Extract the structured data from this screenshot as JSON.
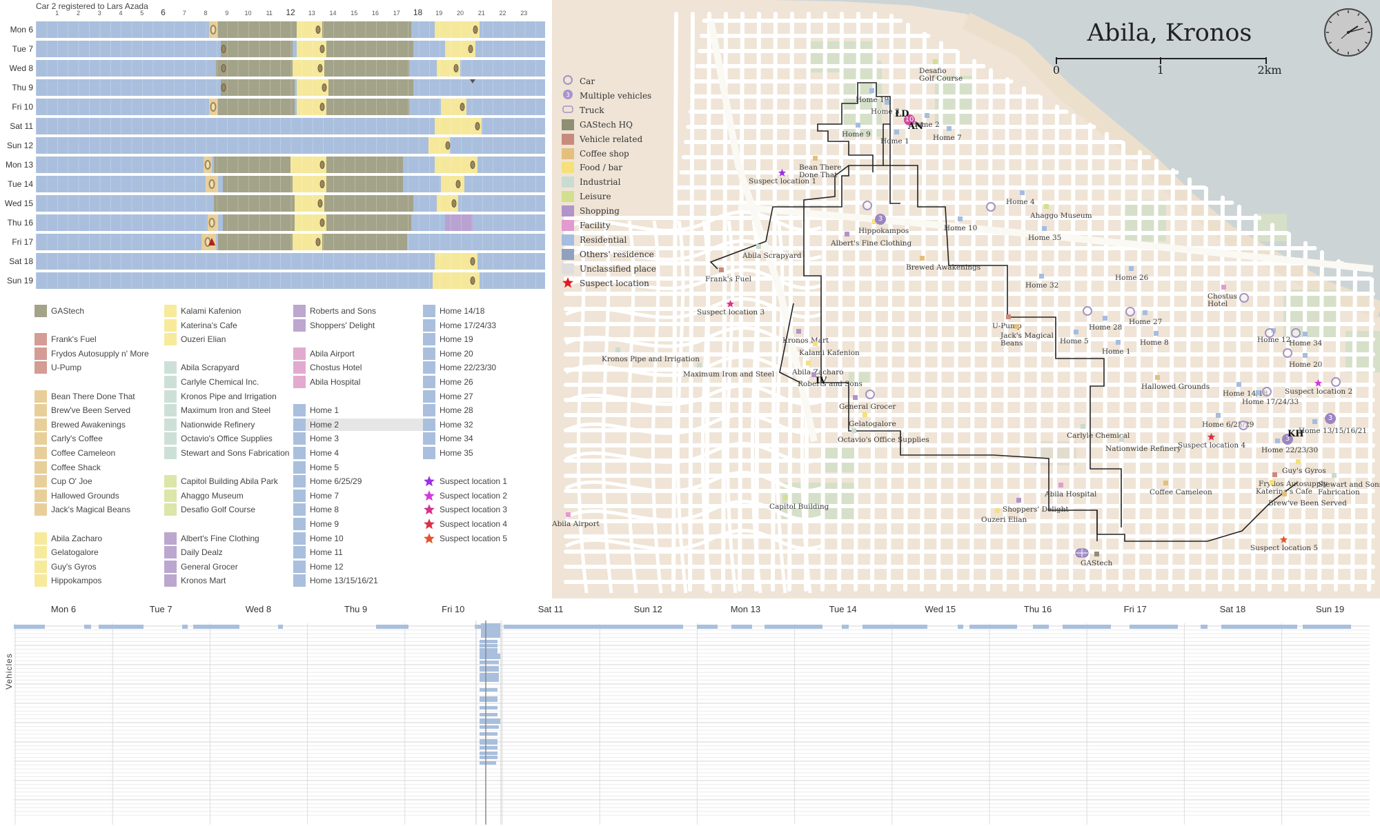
{
  "calendar": {
    "title": "Car 2 registered to Lars Azada",
    "hour_ticks": [
      "1",
      "2",
      "3",
      "4",
      "5",
      "6",
      "7",
      "8",
      "9",
      "10",
      "11",
      "12",
      "13",
      "14",
      "15",
      "16",
      "17",
      "18",
      "19",
      "20",
      "21",
      "22",
      "23"
    ],
    "major_hours": [
      "6",
      "12",
      "18"
    ],
    "days": [
      {
        "label": "Mon 6"
      },
      {
        "label": "Tue 7"
      },
      {
        "label": "Wed 8"
      },
      {
        "label": "Thu 9"
      },
      {
        "label": "Fri 10"
      },
      {
        "label": "Sat 11"
      },
      {
        "label": "Sun 12"
      },
      {
        "label": "Mon 13"
      },
      {
        "label": "Tue 14"
      },
      {
        "label": "Wed 15"
      },
      {
        "label": "Thu 16"
      },
      {
        "label": "Fri 17"
      },
      {
        "label": "Sat 18"
      },
      {
        "label": "Sun 19"
      }
    ],
    "colors": {
      "residential": "#a9bfdd",
      "gastech": "#a3a389",
      "food": "#f5e89a",
      "coffee": "#e8cf99",
      "shopping": "#b9a2d2",
      "background": "#ffffff"
    }
  },
  "legend": {
    "columns": [
      [
        {
          "label": "GAStech",
          "color": "#a3a389"
        },
        {
          "label": "",
          "color": ""
        },
        {
          "label": "Frank's Fuel",
          "color": "#d49c93"
        },
        {
          "label": "Frydos Autosupply n' More",
          "color": "#d49c93"
        },
        {
          "label": "U-Pump",
          "color": "#d49c93"
        },
        {
          "label": "",
          "color": ""
        },
        {
          "label": "Bean There Done That",
          "color": "#e8cf99"
        },
        {
          "label": "Brew've Been Served",
          "color": "#e8cf99"
        },
        {
          "label": "Brewed Awakenings",
          "color": "#e8cf99"
        },
        {
          "label": "Carly's Coffee",
          "color": "#e8cf99"
        },
        {
          "label": "Coffee Cameleon",
          "color": "#e8cf99"
        },
        {
          "label": "Coffee Shack",
          "color": "#e8cf99"
        },
        {
          "label": "Cup O' Joe",
          "color": "#e8cf99"
        },
        {
          "label": "Hallowed Grounds",
          "color": "#e8cf99"
        },
        {
          "label": "Jack's Magical Beans",
          "color": "#e8cf99"
        },
        {
          "label": "",
          "color": ""
        },
        {
          "label": "Abila Zacharo",
          "color": "#f7ea9a"
        },
        {
          "label": "Gelatogalore",
          "color": "#f7ea9a"
        },
        {
          "label": "Guy's Gyros",
          "color": "#f7ea9a"
        },
        {
          "label": "Hippokampos",
          "color": "#f7ea9a"
        }
      ],
      [
        {
          "label": "Kalami Kafenion",
          "color": "#f7ea9a"
        },
        {
          "label": "Katerina's Cafe",
          "color": "#f7ea9a"
        },
        {
          "label": "Ouzeri Elian",
          "color": "#f7ea9a"
        },
        {
          "label": "",
          "color": ""
        },
        {
          "label": "Abila Scrapyard",
          "color": "#cde0d8"
        },
        {
          "label": "Carlyle Chemical Inc.",
          "color": "#cde0d8"
        },
        {
          "label": "Kronos Pipe and Irrigation",
          "color": "#cde0d8"
        },
        {
          "label": "Maximum Iron and Steel",
          "color": "#cde0d8"
        },
        {
          "label": "Nationwide Refinery",
          "color": "#cde0d8"
        },
        {
          "label": "Octavio's Office Supplies",
          "color": "#cde0d8"
        },
        {
          "label": "Stewart and Sons Fabrication",
          "color": "#cde0d8"
        },
        {
          "label": "",
          "color": ""
        },
        {
          "label": "Capitol Building Abila Park",
          "color": "#dbe6a8"
        },
        {
          "label": "Ahaggo Museum",
          "color": "#dbe6a8"
        },
        {
          "label": "Desafio Golf Course",
          "color": "#dbe6a8"
        },
        {
          "label": "",
          "color": ""
        },
        {
          "label": "Albert's Fine Clothing",
          "color": "#bca7cf"
        },
        {
          "label": "Daily Dealz",
          "color": "#bca7cf"
        },
        {
          "label": "General Grocer",
          "color": "#bca7cf"
        },
        {
          "label": "Kronos Mart",
          "color": "#bca7cf"
        }
      ],
      [
        {
          "label": "Roberts and Sons",
          "color": "#bca7cf"
        },
        {
          "label": "Shoppers' Delight",
          "color": "#bca7cf"
        },
        {
          "label": "",
          "color": ""
        },
        {
          "label": "Abila Airport",
          "color": "#e2aad0"
        },
        {
          "label": "Chostus Hotel",
          "color": "#e2aad0"
        },
        {
          "label": "Abila Hospital",
          "color": "#e2aad0"
        },
        {
          "label": "",
          "color": ""
        },
        {
          "label": "Home 1",
          "color": "#a9bfdd"
        },
        {
          "label": "Home 2",
          "color": "#a9bfdd",
          "highlight": true
        },
        {
          "label": "Home 3",
          "color": "#a9bfdd"
        },
        {
          "label": "Home 4",
          "color": "#a9bfdd"
        },
        {
          "label": "Home 5",
          "color": "#a9bfdd"
        },
        {
          "label": "Home 6/25/29",
          "color": "#a9bfdd"
        },
        {
          "label": "Home 7",
          "color": "#a9bfdd"
        },
        {
          "label": "Home 8",
          "color": "#a9bfdd"
        },
        {
          "label": "Home 9",
          "color": "#a9bfdd"
        },
        {
          "label": "Home 10",
          "color": "#a9bfdd"
        },
        {
          "label": "Home 11",
          "color": "#a9bfdd"
        },
        {
          "label": "Home 12",
          "color": "#a9bfdd"
        },
        {
          "label": "Home 13/15/16/21",
          "color": "#a9bfdd"
        }
      ],
      [
        {
          "label": "Home 14/18",
          "color": "#a9bfdd"
        },
        {
          "label": "Home 17/24/33",
          "color": "#a9bfdd"
        },
        {
          "label": "Home 19",
          "color": "#a9bfdd"
        },
        {
          "label": "Home 20",
          "color": "#a9bfdd"
        },
        {
          "label": "Home 22/23/30",
          "color": "#a9bfdd"
        },
        {
          "label": "Home 26",
          "color": "#a9bfdd"
        },
        {
          "label": "Home 27",
          "color": "#a9bfdd"
        },
        {
          "label": "Home 28",
          "color": "#a9bfdd"
        },
        {
          "label": "Home 32",
          "color": "#a9bfdd"
        },
        {
          "label": "Home 34",
          "color": "#a9bfdd"
        },
        {
          "label": "Home 35",
          "color": "#a9bfdd"
        },
        {
          "label": "",
          "color": ""
        },
        {
          "label": "Suspect location 1",
          "color": "#9b30e8",
          "star": true
        },
        {
          "label": "Suspect location 2",
          "color": "#d43ad8",
          "star": true
        },
        {
          "label": "Suspect location 3",
          "color": "#d7318f",
          "star": true
        },
        {
          "label": "Suspect location 4",
          "color": "#d83045",
          "star": true
        },
        {
          "label": "Suspect location 5",
          "color": "#e2542e",
          "star": true
        }
      ]
    ]
  },
  "map": {
    "title": "Abila, Kronos",
    "scale": {
      "labels": [
        "0",
        "1",
        "2km"
      ]
    },
    "legend": [
      {
        "label": "Car",
        "kind": "car"
      },
      {
        "label": "Multiple vehicles",
        "kind": "multi",
        "badge": "3"
      },
      {
        "label": "Truck",
        "kind": "truck"
      },
      {
        "label": "GAStech HQ",
        "color": "#8f8f73"
      },
      {
        "label": "Vehicle related",
        "color": "#c98a7e"
      },
      {
        "label": "Coffee shop",
        "color": "#e3c07e"
      },
      {
        "label": "Food / bar",
        "color": "#f5e07c"
      },
      {
        "label": "Industrial",
        "color": "#c8dcd2"
      },
      {
        "label": "Leisure",
        "color": "#d1df8f"
      },
      {
        "label": "Shopping",
        "color": "#b293cc"
      },
      {
        "label": "Facility",
        "color": "#e39ad0"
      },
      {
        "label": "Residential",
        "color": "#a5bde0"
      },
      {
        "label": "Others' residence",
        "color": "#8fa1bf"
      },
      {
        "label": "Unclassified place",
        "color": "#dedede"
      },
      {
        "label": "Suspect location",
        "kind": "star",
        "color": "#e01c22"
      }
    ],
    "places": [
      {
        "label": "Desafio Golf Course",
        "lines": [
          "Desafio",
          "Golf Course"
        ]
      },
      {
        "label": "Home 19"
      },
      {
        "label": "Home 3"
      },
      {
        "label": "Home 2"
      },
      {
        "label": "Home 9"
      },
      {
        "label": "Home 1"
      },
      {
        "label": "Home 7"
      },
      {
        "label": "Bean There Done That",
        "lines": [
          "Bean There",
          "Done That"
        ]
      },
      {
        "label": "Suspect location 1"
      },
      {
        "label": "Home 4"
      },
      {
        "label": "Ahaggo Museum"
      },
      {
        "label": "Home 35"
      },
      {
        "label": "Hippokampos"
      },
      {
        "label": "Home 10"
      },
      {
        "label": "Albert's Fine Clothing"
      },
      {
        "label": "Abila Scrapyard"
      },
      {
        "label": "Brewed Awakenings"
      },
      {
        "label": "Home 32"
      },
      {
        "label": "Home 26"
      },
      {
        "label": "Frank's Fuel"
      },
      {
        "label": "Chostus Hotel",
        "lines": [
          "Chostus",
          "Hotel"
        ]
      },
      {
        "label": "Suspect location 3"
      },
      {
        "label": "U-Pump"
      },
      {
        "label": "Jack's Magical Beans",
        "lines": [
          "Jack's Magical",
          "Beans"
        ]
      },
      {
        "label": "Home 28"
      },
      {
        "label": "Home 27"
      },
      {
        "label": "Home 5"
      },
      {
        "label": "Home 8"
      },
      {
        "label": "Home 1"
      },
      {
        "label": "Home 12"
      },
      {
        "label": "Home 34"
      },
      {
        "label": "Kronos Mart"
      },
      {
        "label": "Kalami Kafenion"
      },
      {
        "label": "Kronos Pipe and Irrigation"
      },
      {
        "label": "Home 20"
      },
      {
        "label": "Maximum Iron and Steel"
      },
      {
        "label": "Abila Zacharo"
      },
      {
        "label": "Roberts and Sons"
      },
      {
        "label": "Hallowed Grounds"
      },
      {
        "label": "Home 14/18"
      },
      {
        "label": "Suspect location 2"
      },
      {
        "label": "Home 17/24/33"
      },
      {
        "label": "General Grocer"
      },
      {
        "label": "Gelatogalore"
      },
      {
        "label": "Home 6/25/29"
      },
      {
        "label": "Home 13/15/16/21"
      },
      {
        "label": "Carlyle Chemical"
      },
      {
        "label": "Octavio's Office Supplies"
      },
      {
        "label": "Nationwide Refinery"
      },
      {
        "label": "Suspect location 4"
      },
      {
        "label": "Home 22/23/30"
      },
      {
        "label": "Guy's Gyros"
      },
      {
        "label": "Frydos Autosupply"
      },
      {
        "label": "Stewart and Sons Fabrication",
        "lines": [
          "Stewart and Sons",
          "Fabrication"
        ]
      },
      {
        "label": "Abila Hospital"
      },
      {
        "label": "Coffee Cameleon"
      },
      {
        "label": "Katerina's Cafe"
      },
      {
        "label": "Brew've Been Served"
      },
      {
        "label": "Capitol Building"
      },
      {
        "label": "Shoppers' Delight"
      },
      {
        "label": "Ouzeri Elian"
      },
      {
        "label": "Abila Airport"
      },
      {
        "label": "Suspect location 5"
      },
      {
        "label": "GAStech"
      }
    ],
    "initials": [
      "LD",
      "AN",
      "IV",
      "KH"
    ],
    "badges": [
      {
        "label": "10"
      },
      {
        "label": "3"
      },
      {
        "label": "3"
      },
      {
        "label": "3"
      }
    ]
  },
  "timeline": {
    "days": [
      "Mon 6",
      "Tue 7",
      "Wed 8",
      "Thu 9",
      "Fri 10",
      "Sat 11",
      "Sun 12",
      "Mon 13",
      "Tue 14",
      "Wed 15",
      "Thu 16",
      "Fri 17",
      "Sat 18",
      "Sun 19"
    ],
    "axis_label": "Vehicles"
  }
}
